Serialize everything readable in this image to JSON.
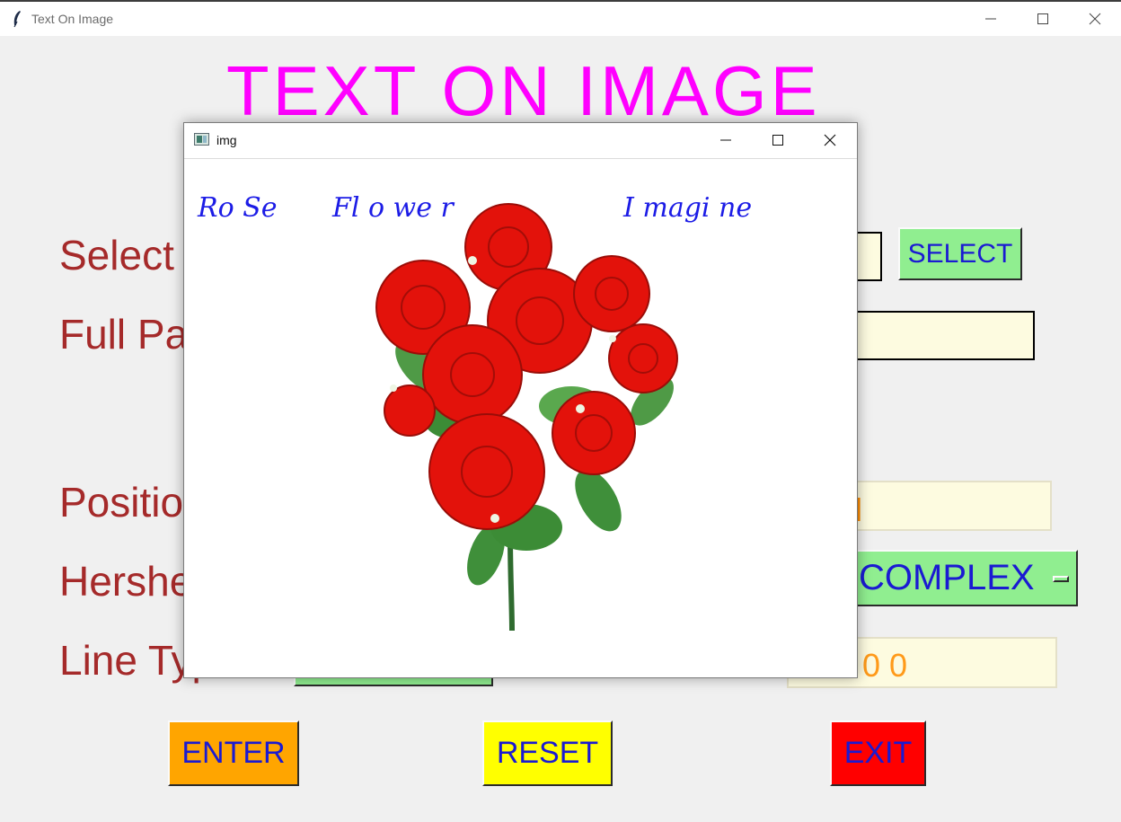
{
  "window": {
    "title": "Text On Image",
    "icon": "feather-icon"
  },
  "heading": "TEXT  ON  IMAGE",
  "labels": {
    "select": "Select",
    "full_path": "Full Pa",
    "position": "Positio",
    "hershey": "Hershe",
    "line_type": "Line Typ"
  },
  "buttons": {
    "select": "SELECT",
    "enter": "ENTER",
    "reset": "RESET",
    "exit": "EXIT"
  },
  "fields": {
    "position_value": "l",
    "font_value": "COMPLEX",
    "color_value": "0 0"
  },
  "popup": {
    "title": "img",
    "overlay_text": [
      "Ro Se",
      "Fl o we r",
      "I magi ne"
    ]
  },
  "colors": {
    "heading": "#ff00ff",
    "label": "#a52a2a",
    "button_text": "#1a1ad2",
    "select_button": "#90ee90",
    "enter_button": "#ffa500",
    "reset_button": "#ffff00",
    "exit_button": "#ff0000",
    "entry_bg": "#fdfbe0",
    "overlay_text": "#1c1ce6"
  }
}
